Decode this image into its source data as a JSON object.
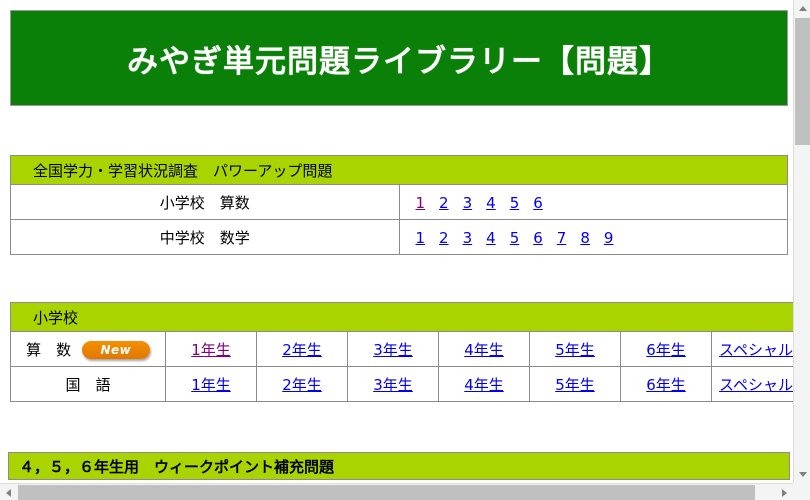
{
  "banner": {
    "title": "みやぎ単元問題ライブラリー【問題】",
    "background_color": "#0a8008",
    "text_color": "#ffffff"
  },
  "colors": {
    "banner_green": "#0a8008",
    "header_lime": "#aad400",
    "link_blue": "#0000ee",
    "link_visited_purple": "#800080",
    "badge_orange": "#e07800",
    "border_gray": "#8c8c8c",
    "scrollbar_thumb": "#c0c0c0"
  },
  "sections": {
    "powerup": {
      "header": "全国学力・学習状況調査　パワーアップ問題",
      "rows": [
        {
          "label": "小学校　算数",
          "links": [
            {
              "label": "1",
              "visited": true
            },
            {
              "label": "2",
              "visited": false
            },
            {
              "label": "3",
              "visited": false
            },
            {
              "label": "4",
              "visited": false
            },
            {
              "label": "5",
              "visited": false
            },
            {
              "label": "6",
              "visited": false
            }
          ]
        },
        {
          "label": "中学校　数学",
          "links": [
            {
              "label": "1",
              "visited": false
            },
            {
              "label": "2",
              "visited": false
            },
            {
              "label": "3",
              "visited": false
            },
            {
              "label": "4",
              "visited": false
            },
            {
              "label": "5",
              "visited": false
            },
            {
              "label": "6",
              "visited": false
            },
            {
              "label": "7",
              "visited": false
            },
            {
              "label": "8",
              "visited": false
            },
            {
              "label": "9",
              "visited": false
            }
          ]
        }
      ]
    },
    "elementary": {
      "header": "小学校",
      "rows": [
        {
          "label": "算　数",
          "badge": "New",
          "links": [
            {
              "label": "1年生",
              "visited": true
            },
            {
              "label": "2年生",
              "visited": false
            },
            {
              "label": "3年生",
              "visited": false
            },
            {
              "label": "4年生",
              "visited": false
            },
            {
              "label": "5年生",
              "visited": false
            },
            {
              "label": "6年生",
              "visited": false
            },
            {
              "label": "スペシャル",
              "visited": false
            }
          ]
        },
        {
          "label": "国　語",
          "badge": null,
          "links": [
            {
              "label": "1年生",
              "visited": false
            },
            {
              "label": "2年生",
              "visited": false
            },
            {
              "label": "3年生",
              "visited": false
            },
            {
              "label": "4年生",
              "visited": false
            },
            {
              "label": "5年生",
              "visited": false
            },
            {
              "label": "6年生",
              "visited": false
            },
            {
              "label": "スペシャル",
              "visited": false
            }
          ]
        }
      ]
    },
    "weakpoint": {
      "header": "４，５，６年生用　ウィークポイント補充問題"
    }
  },
  "scrollbars": {
    "vertical": {
      "up_icon": "arrow-up-icon",
      "down_icon": "arrow-down-icon"
    },
    "horizontal": {
      "left_icon": "arrow-left-icon",
      "right_icon": "arrow-right-icon"
    }
  }
}
